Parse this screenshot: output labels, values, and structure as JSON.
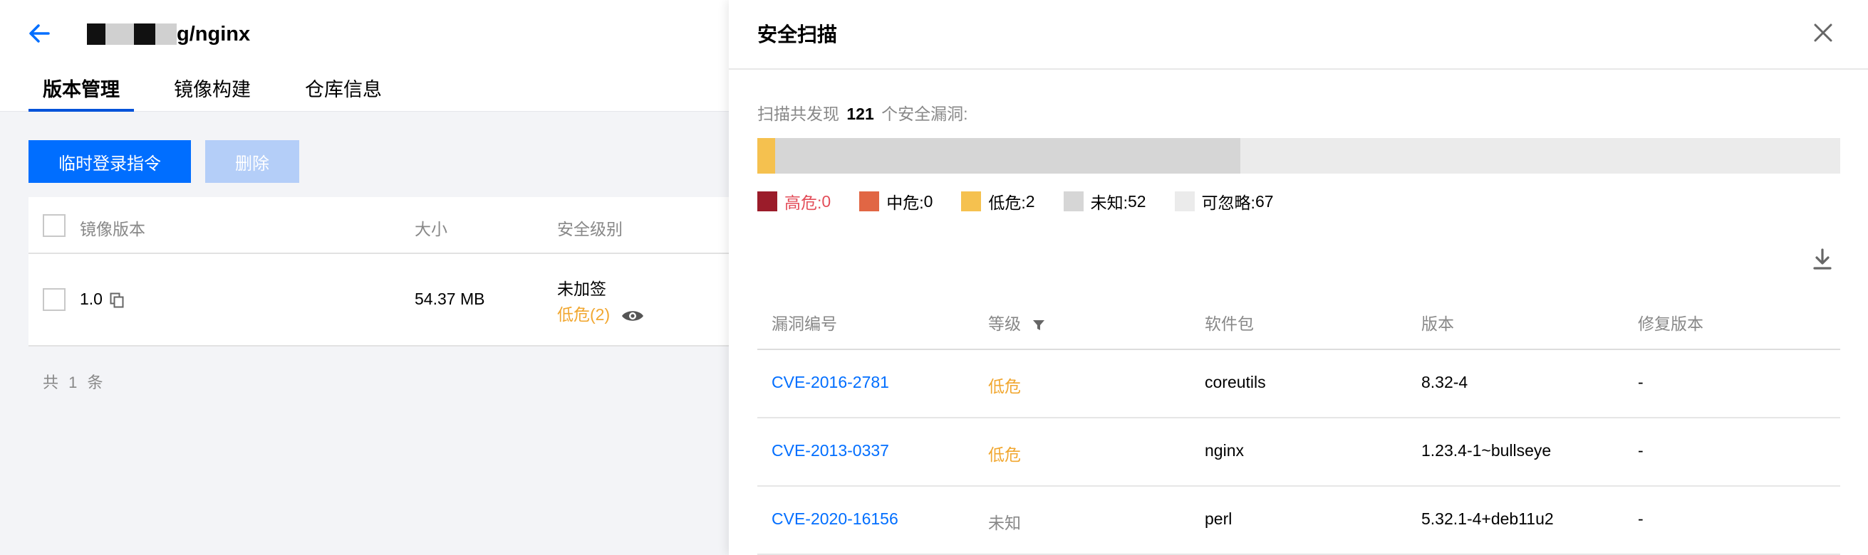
{
  "left": {
    "title_suffix": "g/nginx",
    "tabs": [
      "版本管理",
      "镜像构建",
      "仓库信息"
    ],
    "buttons": {
      "primary": "临时登录指令",
      "delete": "删除"
    },
    "table": {
      "headers": [
        "镜像版本",
        "大小",
        "安全级别"
      ],
      "rows": [
        {
          "version": "1.0",
          "size": "54.37 MB",
          "sign": "未加签",
          "risk": "低危(2)"
        }
      ]
    },
    "total": "共 1 条"
  },
  "drawer": {
    "title": "安全扫描",
    "summary": {
      "prefix": "扫描共发现",
      "count": "121",
      "suffix": "个安全漏洞:"
    },
    "counts": {
      "high": 0,
      "medium": 0,
      "low": 2,
      "unknown": 52,
      "ignorable": 67
    },
    "legend": [
      {
        "label": "高危:",
        "value": "0",
        "color": "#9b1c2a",
        "text_color": "#e34d59"
      },
      {
        "label": "中危:",
        "value": "0",
        "color": "#e16644",
        "text_color": "#000000"
      },
      {
        "label": "低危:",
        "value": "2",
        "color": "#f5c14f",
        "text_color": "#000000"
      },
      {
        "label": "未知:",
        "value": "52",
        "color": "#d6d6d6",
        "text_color": "#000000"
      },
      {
        "label": "可忽略:",
        "value": "67",
        "color": "#ebebeb",
        "text_color": "#000000"
      }
    ],
    "table": {
      "headers": [
        "漏洞编号",
        "等级",
        "软件包",
        "版本",
        "修复版本"
      ],
      "rows": [
        {
          "cve": "CVE-2016-2781",
          "level": "低危",
          "level_type": "low",
          "package": "coreutils",
          "version": "8.32-4",
          "fixed": "-"
        },
        {
          "cve": "CVE-2013-0337",
          "level": "低危",
          "level_type": "low",
          "package": "nginx",
          "version": "1.23.4-1~bullseye",
          "fixed": "-"
        },
        {
          "cve": "CVE-2020-16156",
          "level": "未知",
          "level_type": "unknown",
          "package": "perl",
          "version": "5.32.1-4+deb11u2",
          "fixed": "-"
        }
      ]
    }
  }
}
